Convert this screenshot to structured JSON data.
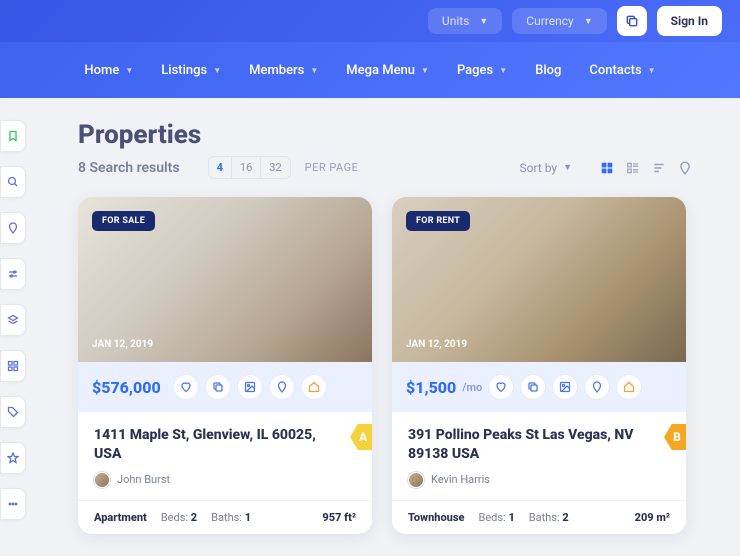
{
  "topbar": {
    "units": "Units",
    "currency": "Currency",
    "signin": "Sign In"
  },
  "nav": [
    "Home",
    "Listings",
    "Members",
    "Mega Menu",
    "Pages",
    "Blog",
    "Contacts"
  ],
  "nav_has_chevron": [
    true,
    true,
    true,
    true,
    true,
    false,
    true
  ],
  "page": {
    "title": "Properties",
    "results_count": "8",
    "results_label": "Search results"
  },
  "perpage": {
    "options": [
      "4",
      "16",
      "32"
    ],
    "active_index": 0,
    "label": "PER PAGE"
  },
  "sort": {
    "label": "Sort by"
  },
  "cards": [
    {
      "badge": "FOR SALE",
      "date": "JAN 12, 2019",
      "price": "$576,000",
      "price_suffix": "",
      "address": "1411 Maple St, Glenview, IL 60025, USA",
      "agent": "John Burst",
      "grade": "A",
      "type": "Apartment",
      "beds_label": "Beds:",
      "beds": "2",
      "baths_label": "Baths:",
      "baths": "1",
      "area": "957 ft²"
    },
    {
      "badge": "FOR RENT",
      "date": "JAN 12, 2019",
      "price": "$1,500",
      "price_suffix": "/mo",
      "address": "391 Pollino Peaks St Las Vegas, NV 89138 USA",
      "agent": "Kevin Harris",
      "grade": "B",
      "type": "Townhouse",
      "beds_label": "Beds:",
      "beds": "1",
      "baths_label": "Baths:",
      "baths": "2",
      "area": "209 m²"
    }
  ]
}
